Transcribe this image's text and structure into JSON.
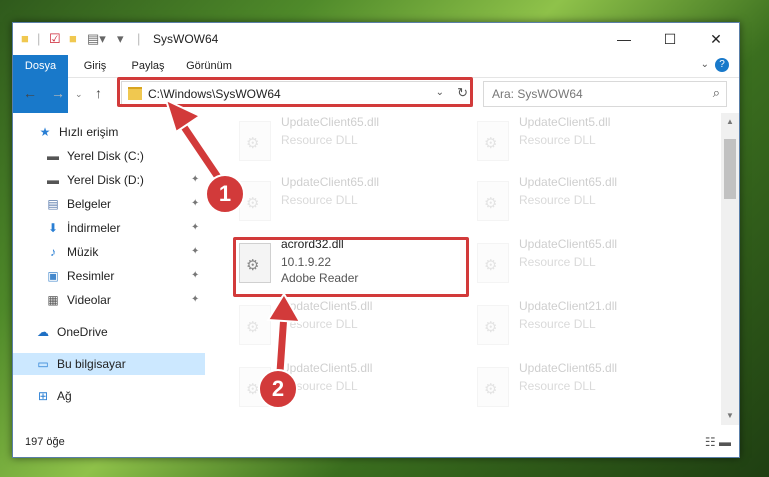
{
  "window": {
    "title": "SysWOW64",
    "controls": {
      "minimize": "—",
      "maximize": "☐",
      "close": "✕"
    }
  },
  "ribbon": {
    "tabs": [
      "Dosya",
      "Giriş",
      "Paylaş",
      "Görünüm"
    ],
    "help": "?"
  },
  "address": {
    "path": "C:\\Windows\\SysWOW64"
  },
  "search": {
    "placeholder": "Ara: SysWOW64"
  },
  "sidebar": {
    "items": [
      {
        "label": "Hızlı erişim",
        "icon": "star-icon"
      },
      {
        "label": "Yerel Disk (C:)",
        "icon": "drive-icon",
        "pinned": true
      },
      {
        "label": "Yerel Disk (D:)",
        "icon": "drive-icon",
        "pinned": true
      },
      {
        "label": "Belgeler",
        "icon": "documents-icon",
        "pinned": true
      },
      {
        "label": "İndirmeler",
        "icon": "download-icon",
        "pinned": true
      },
      {
        "label": "Müzik",
        "icon": "music-icon",
        "pinned": true
      },
      {
        "label": "Resimler",
        "icon": "pictures-icon",
        "pinned": true
      },
      {
        "label": "Videolar",
        "icon": "videos-icon",
        "pinned": true
      },
      {
        "label": "OneDrive",
        "icon": "cloud-icon"
      },
      {
        "label": "Bu bilgisayar",
        "icon": "computer-icon",
        "selected": true
      },
      {
        "label": "Ağ",
        "icon": "network-icon"
      }
    ]
  },
  "files": [
    {
      "name": "UpdateClient65.dll",
      "line2": "Resource DLL",
      "faded": true
    },
    {
      "name": "UpdateClient5.dll",
      "line2": "Resource DLL",
      "faded": true
    },
    {
      "name": "UpdateClient65.dll",
      "line2": "Resource DLL",
      "faded": true
    },
    {
      "name": "UpdateClient65.dll",
      "line2": "Resource DLL",
      "faded": true
    },
    {
      "name": "acrord32.dll",
      "line2": "10.1.9.22",
      "line3": "Adobe Reader",
      "faded": false
    },
    {
      "name": "UpdateClient65.dll",
      "line2": "Resource DLL",
      "faded": true
    },
    {
      "name": "UpdateClient5.dll",
      "line2": "Resource DLL",
      "faded": true
    },
    {
      "name": "UpdateClient21.dll",
      "line2": "Resource DLL",
      "faded": true
    },
    {
      "name": "UpdateClient5.dll",
      "line2": "Resource DLL",
      "faded": true
    },
    {
      "name": "UpdateClient65.dll",
      "line2": "Resource DLL",
      "faded": true
    }
  ],
  "status": {
    "count": "197 öğe"
  },
  "annotations": {
    "step1": "1",
    "step2": "2"
  },
  "colors": {
    "accent": "#1979ca",
    "highlight": "#d23a3a",
    "selected": "#cce8ff"
  }
}
